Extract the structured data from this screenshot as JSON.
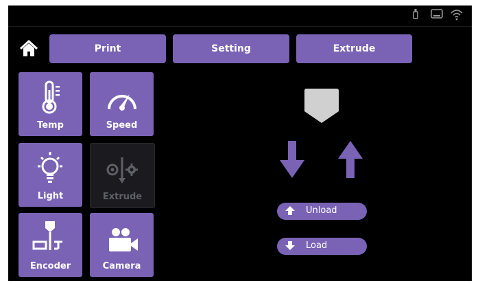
{
  "status_bar": {
    "icons": [
      "usb-icon",
      "storage-icon",
      "wifi-icon"
    ]
  },
  "nav": {
    "home_icon": "home-icon",
    "tabs": [
      {
        "label": "Print"
      },
      {
        "label": "Setting"
      },
      {
        "label": "Extrude"
      }
    ]
  },
  "tiles": [
    {
      "label": "Temp",
      "icon": "thermometer-icon",
      "enabled": true
    },
    {
      "label": "Speed",
      "icon": "speedometer-icon",
      "enabled": true
    },
    {
      "label": "Light",
      "icon": "lightbulb-icon",
      "enabled": true
    },
    {
      "label": "Extrude",
      "icon": "extrude-gear-icon",
      "enabled": false
    },
    {
      "label": "Encoder",
      "icon": "encoder-icon",
      "enabled": true
    },
    {
      "label": "Camera",
      "icon": "camera-icon",
      "enabled": true
    }
  ],
  "extruder_panel": {
    "nozzle_icon": "nozzle-icon",
    "down_arrow_icon": "arrow-down-icon",
    "up_arrow_icon": "arrow-up-icon",
    "unload_label": "Unload",
    "load_label": "Load"
  },
  "colors": {
    "accent": "#7a63b5",
    "background": "#000000",
    "disabled": "#1b1b1f"
  }
}
